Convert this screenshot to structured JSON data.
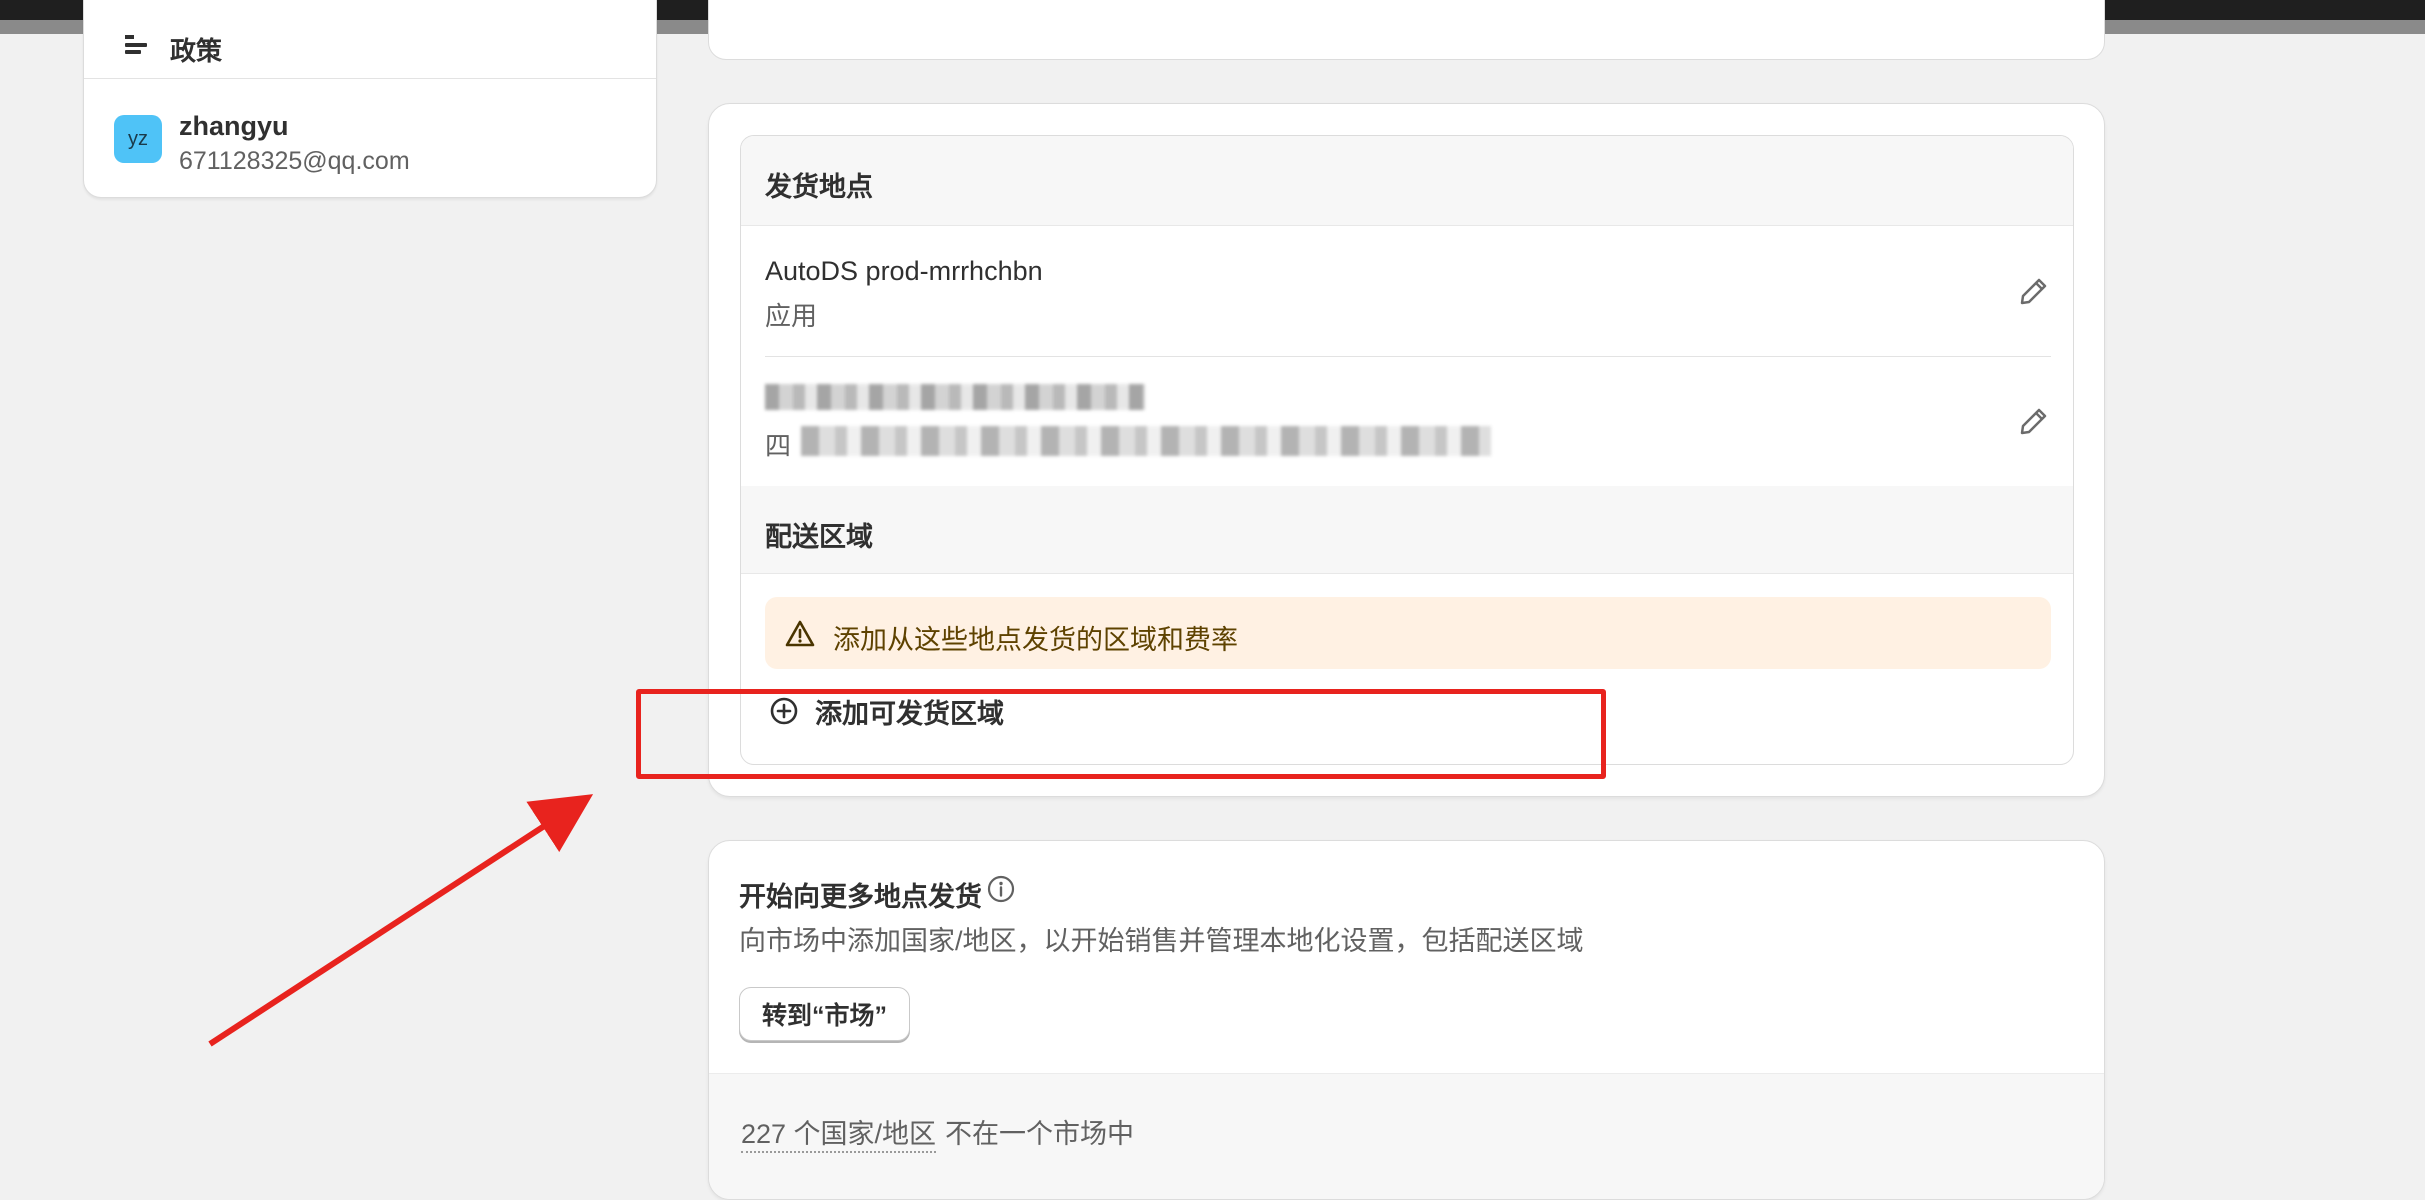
{
  "sidebar": {
    "policy_label": "政策",
    "user": {
      "initials": "yz",
      "name": "zhangyu",
      "email": "671128325@qq.com"
    }
  },
  "shipping": {
    "origins_title": "发货地点",
    "locations": [
      {
        "name": "AutoDS prod-mrrhchbn",
        "type": "应用"
      },
      {
        "name": "",
        "address_start": "四"
      }
    ],
    "zones_title": "配送区域",
    "warning_text": "添加从这些地点发货的区域和费率",
    "add_zone_label": "添加可发货区域"
  },
  "markets": {
    "title": "开始向更多地点发货",
    "description": "向市场中添加国家/地区，以开始销售并管理本地化设置，包括配送区域",
    "button_label": "转到“市场”",
    "count_link": "227 个国家/地区",
    "count_tail": "不在一个市场中"
  },
  "colors": {
    "annotation_red": "#e8231e",
    "warning_bg": "#fff1e3",
    "avatar_bg": "#4fc3f7"
  }
}
